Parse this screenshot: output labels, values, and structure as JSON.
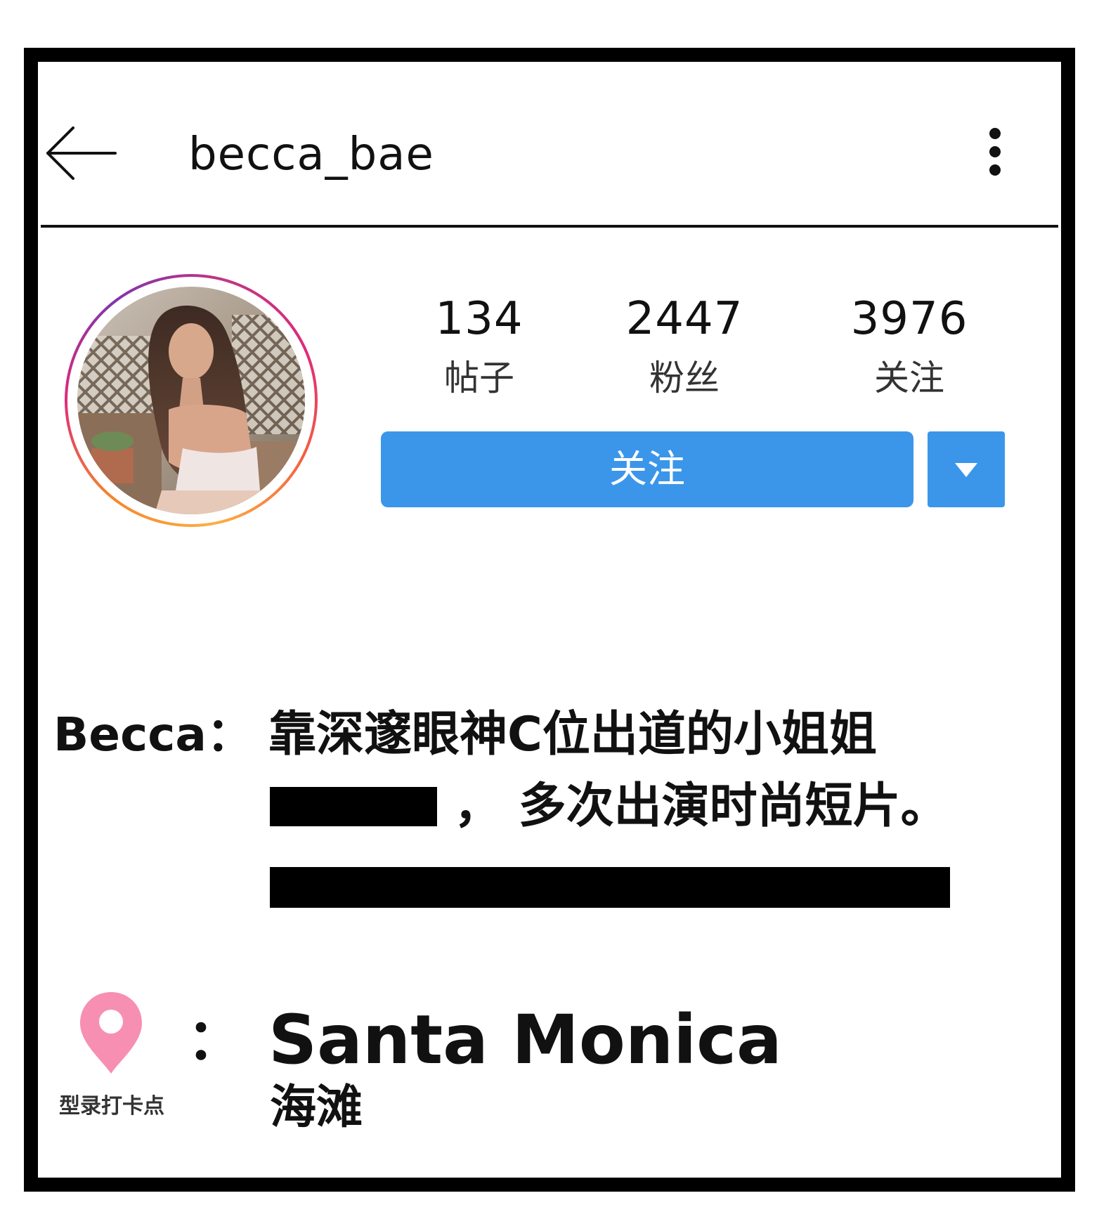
{
  "header": {
    "username": "becca_bae",
    "back_icon": "arrow-left-icon",
    "more_icon": "more-vertical-icon"
  },
  "profile": {
    "avatar_icon": "profile-photo",
    "stats": [
      {
        "value": "134",
        "label": "帖子"
      },
      {
        "value": "2447",
        "label": "粉丝"
      },
      {
        "value": "3976",
        "label": "关注"
      }
    ],
    "follow_label": "关注",
    "dropdown_icon": "caret-down-icon",
    "accent_color": "#3b96ea"
  },
  "bio": {
    "name": "Becca：",
    "line1": "靠深邃眼神C位出道的小姐姐",
    "line2": "，  多次出演时尚短片。"
  },
  "location": {
    "pin_icon": "map-pin-icon",
    "pin_label": "型录打卡点",
    "colon": "：",
    "name": "Santa Monica",
    "subtitle": "海滩",
    "pin_color": "#f78fb3"
  }
}
